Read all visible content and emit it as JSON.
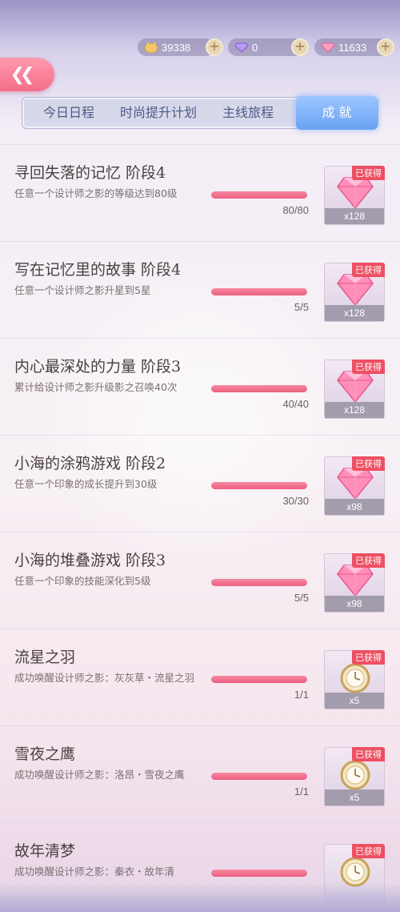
{
  "currencies": [
    {
      "name": "coin-icon",
      "value": "39338"
    },
    {
      "name": "purple-diamond-icon",
      "value": "0"
    },
    {
      "name": "pink-diamond-icon",
      "value": "11633"
    }
  ],
  "tabs": [
    {
      "label": "今日日程",
      "active": false
    },
    {
      "label": "时尚提升计划",
      "active": false
    },
    {
      "label": "主线旅程",
      "active": false
    },
    {
      "label": "成 就",
      "active": true
    }
  ],
  "achievements": [
    {
      "title": "寻回失落的记忆 阶段4",
      "desc": "任意一个设计师之影的等级达到80级",
      "progress": "80/80",
      "fill": 1.0,
      "reward_icon": "pink-diamond-icon",
      "qty": "x128",
      "badge": "已获得"
    },
    {
      "title": "写在记忆里的故事 阶段4",
      "desc": "任意一个设计师之影升星到5星",
      "progress": "5/5",
      "fill": 1.0,
      "reward_icon": "pink-diamond-icon",
      "qty": "x128",
      "badge": "已获得"
    },
    {
      "title": "内心最深处的力量 阶段3",
      "desc": "累计给设计师之影升级影之召唤40次",
      "progress": "40/40",
      "fill": 1.0,
      "reward_icon": "pink-diamond-icon",
      "qty": "x128",
      "badge": "已获得"
    },
    {
      "title": "小海的涂鸦游戏 阶段2",
      "desc": "任意一个印象的成长提升到30级",
      "progress": "30/30",
      "fill": 1.0,
      "reward_icon": "pink-diamond-icon",
      "qty": "x98",
      "badge": "已获得"
    },
    {
      "title": "小海的堆叠游戏 阶段3",
      "desc": "任意一个印象的技能深化到5级",
      "progress": "5/5",
      "fill": 1.0,
      "reward_icon": "pink-diamond-icon",
      "qty": "x98",
      "badge": "已获得"
    },
    {
      "title": "流星之羽",
      "desc": "成功唤醒设计师之影：灰灰草・流星之羽",
      "progress": "1/1",
      "fill": 1.0,
      "reward_icon": "gold-pocket-watch-icon",
      "qty": "x5",
      "badge": "已获得"
    },
    {
      "title": "雪夜之鹰",
      "desc": "成功唤醒设计师之影：洛昂・雪夜之鹰",
      "progress": "1/1",
      "fill": 1.0,
      "reward_icon": "gold-pocket-watch-icon",
      "qty": "x5",
      "badge": "已获得"
    },
    {
      "title": "故年清梦",
      "desc": "成功唤醒设计师之影：秦衣・故年清",
      "progress": "",
      "fill": 1.0,
      "reward_icon": "gold-pocket-watch-icon",
      "qty": "",
      "badge": "已获得"
    }
  ]
}
